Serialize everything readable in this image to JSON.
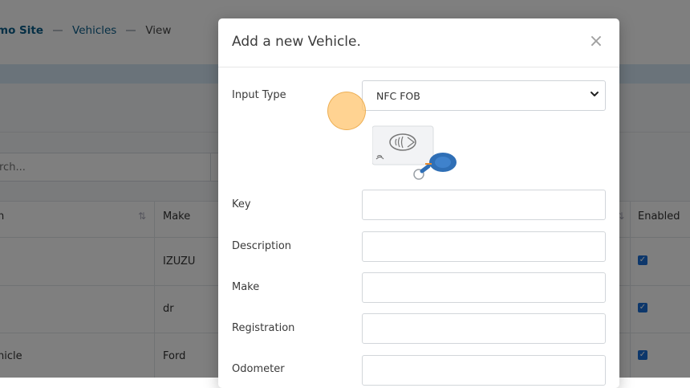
{
  "breadcrumb": {
    "site": "mo Site",
    "vehicles": "Vehicles",
    "current": "View"
  },
  "search": {
    "placeholder": "rch..."
  },
  "table": {
    "columns": [
      "n",
      "Make",
      "Enabled"
    ],
    "rows": [
      {
        "name": "",
        "make": "IZUZU",
        "enabled": true
      },
      {
        "name": "",
        "make": "dr",
        "enabled": true
      },
      {
        "name": "nicle",
        "make": "Ford",
        "enabled": true
      }
    ]
  },
  "modal": {
    "title": "Add a new Vehicle.",
    "close": "×",
    "input_type": {
      "label": "Input Type",
      "value": "NFC FOB",
      "options": [
        "NFC FOB"
      ]
    },
    "fields": {
      "key": {
        "label": "Key",
        "value": ""
      },
      "description": {
        "label": "Description",
        "value": ""
      },
      "make": {
        "label": "Make",
        "value": ""
      },
      "registration": {
        "label": "Registration",
        "value": ""
      },
      "odometer": {
        "label": "Odometer",
        "value": ""
      }
    }
  },
  "icons": {
    "close": "close-icon",
    "chevron": "chevron-down-icon",
    "sort": "sort-icon",
    "nfc_image": "nfc-fob-image"
  },
  "colors": {
    "link": "#0b5e8a",
    "checkbox": "#1a6fd6",
    "highlight": "#ffc46e"
  }
}
